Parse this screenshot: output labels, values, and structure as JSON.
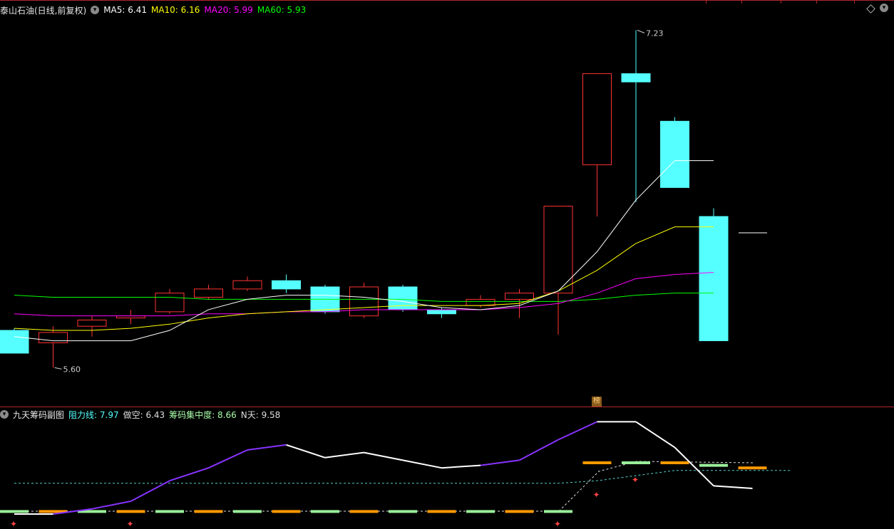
{
  "main": {
    "title": "泰山石油(日线,前复权)",
    "ma": [
      {
        "label": "MA5:",
        "value": "6.41",
        "color": "#ffffff"
      },
      {
        "label": "MA10:",
        "value": "6.16",
        "color": "#ffff00"
      },
      {
        "label": "MA20:",
        "value": "5.99",
        "color": "#ff00ff"
      },
      {
        "label": "MA60:",
        "value": "5.93",
        "color": "#00ff00"
      }
    ],
    "high_label": "7.23",
    "low_label": "5.60",
    "badge": "榜"
  },
  "sub": {
    "title": "九天筹码副图",
    "items": [
      {
        "label": "阻力线:",
        "value": "7.97",
        "color": "#55ffff"
      },
      {
        "label": "做空:",
        "value": "6.43",
        "color": "#dddddd"
      },
      {
        "label": "筹码集中度:",
        "value": "8.66",
        "color": "#a8ffa8"
      },
      {
        "label": "N天:",
        "value": "9.58",
        "color": "#dddddd"
      }
    ]
  },
  "colors": {
    "up": "#ff3333",
    "down": "#55ffff",
    "border": "#b3262b"
  },
  "icons": [
    "chevron-down-icon",
    "diamond-icon",
    "settings-icon",
    "butterfly-icon"
  ],
  "chart_data": {
    "type": "candlestick",
    "price_range": [
      5.45,
      7.3
    ],
    "candles": [
      {
        "o": 5.78,
        "c": 5.67,
        "h": 5.79,
        "l": 5.67
      },
      {
        "o": 5.72,
        "c": 5.77,
        "h": 5.8,
        "l": 5.6
      },
      {
        "o": 5.8,
        "c": 5.83,
        "h": 5.85,
        "l": 5.75
      },
      {
        "o": 5.84,
        "c": 5.85,
        "h": 5.88,
        "l": 5.81
      },
      {
        "o": 5.87,
        "c": 5.96,
        "h": 5.98,
        "l": 5.86
      },
      {
        "o": 5.94,
        "c": 5.98,
        "h": 6.0,
        "l": 5.93
      },
      {
        "o": 5.98,
        "c": 6.02,
        "h": 6.04,
        "l": 5.97
      },
      {
        "o": 6.02,
        "c": 5.98,
        "h": 6.05,
        "l": 5.96
      },
      {
        "o": 5.99,
        "c": 5.87,
        "h": 6.0,
        "l": 5.86
      },
      {
        "o": 5.85,
        "c": 5.99,
        "h": 6.01,
        "l": 5.84
      },
      {
        "o": 5.99,
        "c": 5.88,
        "h": 6.0,
        "l": 5.87
      },
      {
        "o": 5.88,
        "c": 5.86,
        "h": 5.89,
        "l": 5.84
      },
      {
        "o": 5.9,
        "c": 5.93,
        "h": 5.95,
        "l": 5.89
      },
      {
        "o": 5.93,
        "c": 5.96,
        "h": 5.98,
        "l": 5.84
      },
      {
        "o": 5.96,
        "c": 6.38,
        "h": 6.38,
        "l": 5.76
      },
      {
        "o": 6.58,
        "c": 7.02,
        "h": 7.02,
        "l": 6.33
      },
      {
        "o": 7.02,
        "c": 6.98,
        "h": 7.23,
        "l": 6.4
      },
      {
        "o": 6.79,
        "c": 6.47,
        "h": 6.81,
        "l": 6.47
      },
      {
        "o": 6.33,
        "c": 5.73,
        "h": 6.37,
        "l": 5.73
      }
    ],
    "ma5": [
      5.75,
      5.73,
      5.73,
      5.73,
      5.78,
      5.88,
      5.93,
      5.95,
      5.95,
      5.94,
      5.92,
      5.89,
      5.88,
      5.9,
      5.97,
      6.16,
      6.41,
      6.6,
      6.6
    ],
    "ma10": [
      5.79,
      5.78,
      5.78,
      5.79,
      5.81,
      5.84,
      5.86,
      5.87,
      5.88,
      5.89,
      5.9,
      5.9,
      5.9,
      5.91,
      5.97,
      6.07,
      6.2,
      6.28,
      6.28
    ],
    "ma20": [
      5.86,
      5.85,
      5.85,
      5.85,
      5.85,
      5.86,
      5.86,
      5.87,
      5.87,
      5.88,
      5.88,
      5.88,
      5.88,
      5.89,
      5.91,
      5.96,
      6.03,
      6.05,
      6.06
    ],
    "ma60": [
      5.95,
      5.94,
      5.94,
      5.94,
      5.94,
      5.93,
      5.93,
      5.93,
      5.93,
      5.93,
      5.93,
      5.92,
      5.92,
      5.92,
      5.92,
      5.93,
      5.95,
      5.96,
      5.96
    ],
    "sub_white": [
      0,
      0,
      2,
      5,
      13,
      18,
      25,
      27,
      22,
      24,
      21,
      18,
      19,
      21,
      29,
      36,
      36,
      26,
      11,
      10
    ],
    "sub_cyan": [
      12,
      12,
      12,
      12,
      12,
      12,
      12,
      12,
      12,
      12,
      12,
      12,
      12,
      12,
      12,
      13,
      15,
      17,
      17,
      17,
      17
    ],
    "sub_green": [
      1,
      1,
      1,
      1,
      1,
      1,
      1,
      1,
      1,
      1,
      1,
      1,
      1,
      1,
      1,
      20,
      20,
      20,
      19,
      18
    ]
  }
}
